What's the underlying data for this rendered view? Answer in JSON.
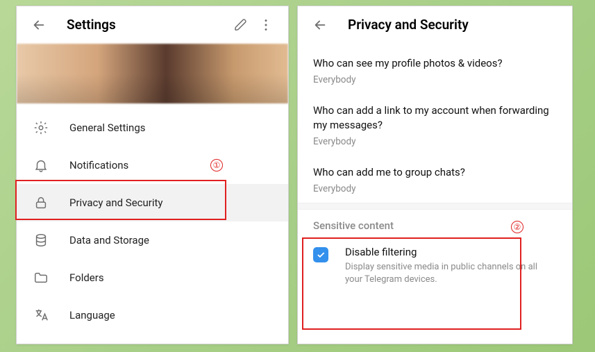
{
  "left": {
    "title": "Settings",
    "menu": [
      {
        "id": "general",
        "label": "General Settings"
      },
      {
        "id": "notifications",
        "label": "Notifications"
      },
      {
        "id": "privacy",
        "label": "Privacy and Security",
        "selected": true
      },
      {
        "id": "data",
        "label": "Data and Storage"
      },
      {
        "id": "folders",
        "label": "Folders"
      },
      {
        "id": "language",
        "label": "Language"
      }
    ]
  },
  "right": {
    "title": "Privacy and Security",
    "items": [
      {
        "q": "Who can see my profile photos & videos?",
        "a": "Everybody"
      },
      {
        "q": "Who can add a link to my account when forwarding my messages?",
        "a": "Everybody"
      },
      {
        "q": "Who can add me to group chats?",
        "a": "Everybody"
      }
    ],
    "sensitive": {
      "section": "Sensitive content",
      "title": "Disable filtering",
      "desc": "Display sensitive media in public channels on all your Telegram devices.",
      "checked": true
    }
  },
  "annotations": {
    "label1": "①",
    "label2": "②"
  }
}
